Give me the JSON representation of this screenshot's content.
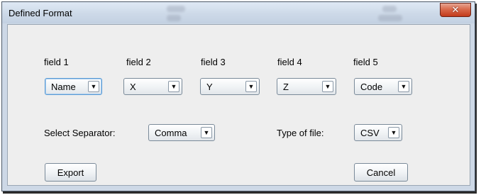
{
  "window": {
    "title": "Defined Format",
    "close_glyph": "✕"
  },
  "fields": [
    {
      "label": "field 1",
      "value": "Name"
    },
    {
      "label": "field 2",
      "value": "X"
    },
    {
      "label": "field 3",
      "value": "Y"
    },
    {
      "label": "field 4",
      "value": "Z"
    },
    {
      "label": "field 5",
      "value": "Code"
    }
  ],
  "separator": {
    "label": "Select Separator:",
    "value": "Comma"
  },
  "file_type": {
    "label": "Type of file:",
    "value": "CSV"
  },
  "buttons": {
    "export": "Export",
    "cancel": "Cancel"
  },
  "icons": {
    "dropdown": "chevron-down-icon",
    "close": "close-icon"
  },
  "colors": {
    "window_frame": "#cdd8e6",
    "client_bg": "#eeeeee",
    "close_button": "#c8442a",
    "focus_ring": "#5b9bd5"
  }
}
